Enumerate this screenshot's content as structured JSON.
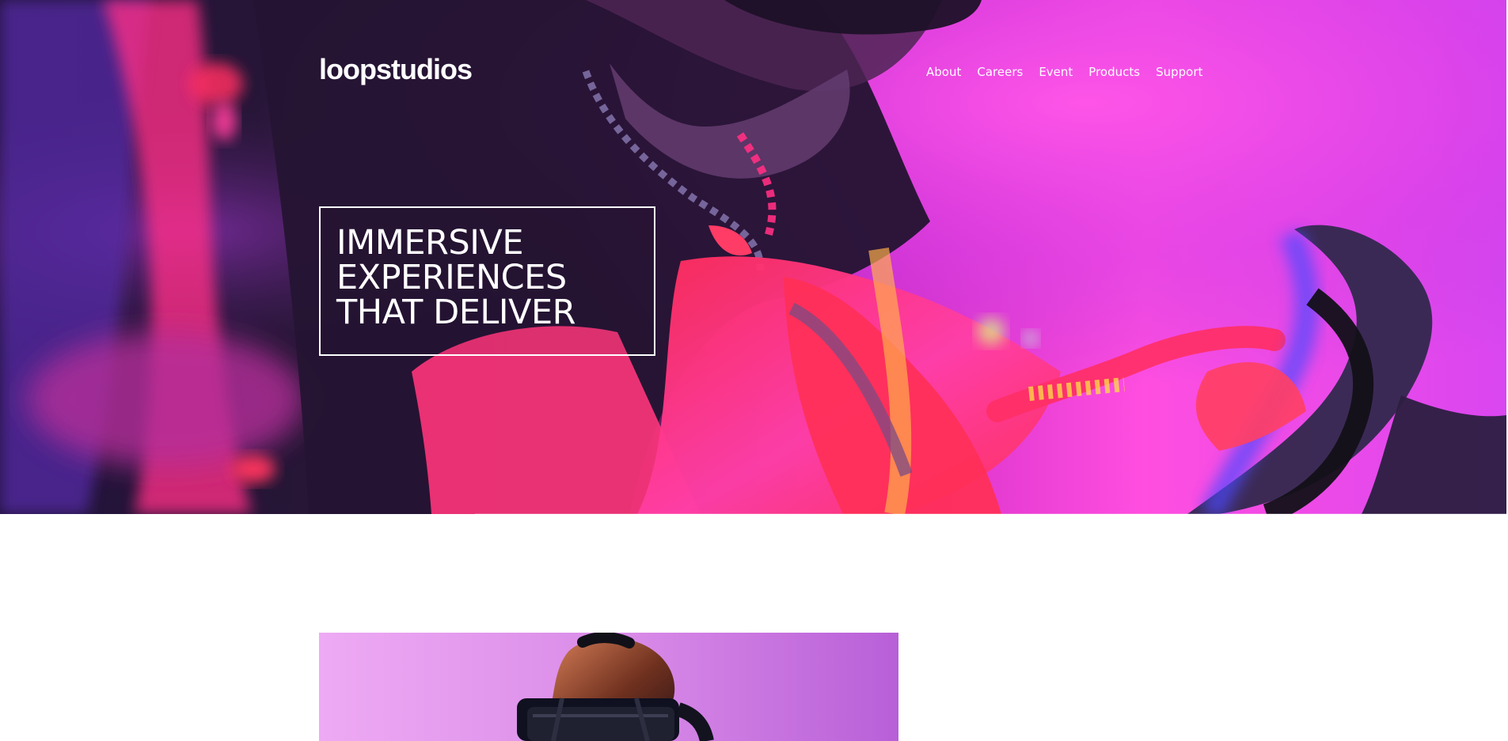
{
  "header": {
    "logo": "loopstudios",
    "nav": [
      "About",
      "Careers",
      "Event",
      "Products",
      "Support"
    ]
  },
  "hero": {
    "headline": "IMMERSIVE EXPERIENCES THAT DELIVER",
    "headline_lines": [
      "IMMERSIVE",
      "EXPERIENCES",
      "THAT DELIVER"
    ]
  },
  "colors": {
    "hero_pink": "#ff3fd4",
    "hero_blue": "#3a32d8",
    "hero_red": "#ff2a4c",
    "hero_dark": "#261534",
    "white": "#ffffff",
    "feature_lilac": "#d98ee8"
  }
}
